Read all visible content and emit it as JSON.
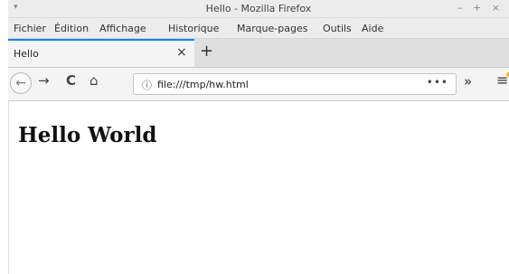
{
  "window": {
    "title": "Hello - Mozilla Firefox",
    "menu_glyph": "▾",
    "controls": "–  +  ×"
  },
  "menubar": {
    "items": [
      "Fichier",
      "Édition",
      "Affichage",
      "Historique",
      "Marque-pages",
      "Outils",
      "Aide"
    ]
  },
  "tabs": {
    "active_title": "Hello",
    "close_glyph": "×",
    "new_tab_glyph": "+"
  },
  "navbar": {
    "back_glyph": "←",
    "forward_glyph": "→",
    "reload_glyph": "C",
    "home_glyph": "⌂",
    "info_glyph": "ⓘ",
    "url": "file:///tmp/hw.html",
    "page_actions_glyph": "•••",
    "overflow_glyph": "»",
    "menu_glyph": "≡"
  },
  "page": {
    "heading": "Hello World"
  }
}
